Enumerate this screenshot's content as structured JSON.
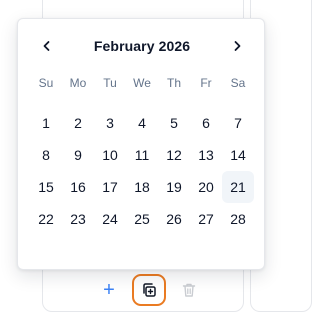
{
  "calendar": {
    "month_label": "February 2026",
    "weekdays": [
      "Su",
      "Mo",
      "Tu",
      "We",
      "Th",
      "Fr",
      "Sa"
    ],
    "weeks": [
      [
        "1",
        "2",
        "3",
        "4",
        "5",
        "6",
        "7"
      ],
      [
        "8",
        "9",
        "10",
        "11",
        "12",
        "13",
        "14"
      ],
      [
        "15",
        "16",
        "17",
        "18",
        "19",
        "20",
        "21"
      ],
      [
        "22",
        "23",
        "24",
        "25",
        "26",
        "27",
        "28"
      ]
    ],
    "highlighted_day": "21",
    "prev_icon": "chevron-left-icon",
    "next_icon": "chevron-right-icon"
  },
  "toolbar": {
    "add_icon": "plus-icon",
    "add_glyph": "+",
    "duplicate_icon": "duplicate-icon",
    "delete_icon": "trash-icon"
  },
  "colors": {
    "accent_blue": "#3b82f6",
    "focus_orange": "#ea7b22",
    "highlight_bg": "#f1f5f9",
    "muted_text": "#64748b",
    "text": "#0f172a"
  }
}
